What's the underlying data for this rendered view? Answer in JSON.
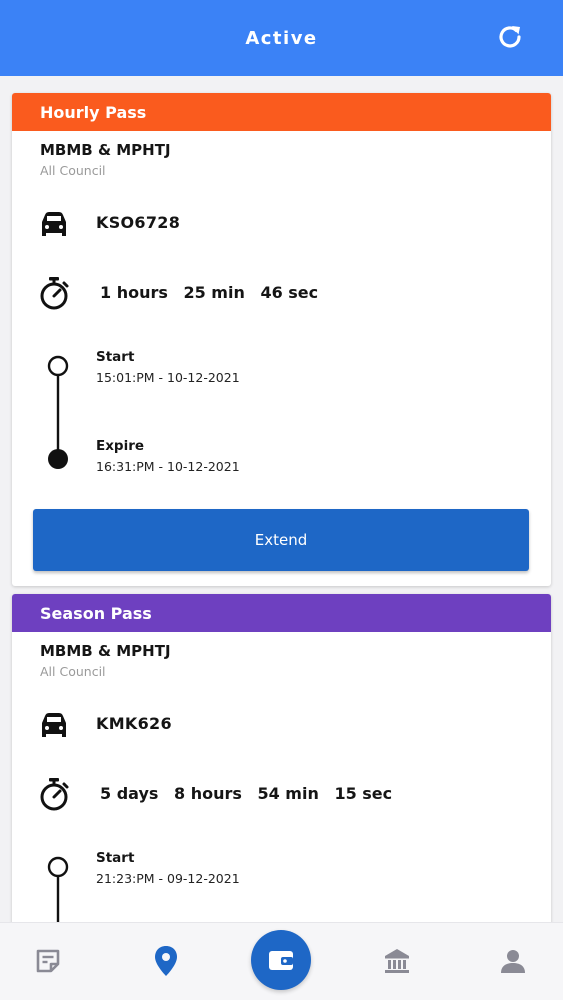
{
  "header": {
    "title": "Active"
  },
  "passes": [
    {
      "type_label": "Hourly Pass",
      "band_color": "#fa5b1e",
      "council": "MBMB & MPHTJ",
      "council_sub": "All Council",
      "plate": "KSO6728",
      "remaining": [
        "1 hours",
        "25 min",
        "46 sec"
      ],
      "start_label": "Start",
      "start_time": "15:01:PM - 10-12-2021",
      "expire_label": "Expire",
      "expire_time": "16:31:PM - 10-12-2021",
      "action_label": "Extend"
    },
    {
      "type_label": "Season Pass",
      "band_color": "#6e40c0",
      "council": "MBMB & MPHTJ",
      "council_sub": "All Council",
      "plate": "KMK626",
      "remaining": [
        "5 days",
        "8 hours",
        "54 min",
        "15 sec"
      ],
      "start_label": "Start",
      "start_time": "21:23:PM - 09-12-2021"
    }
  ],
  "nav": {
    "items": [
      "notes-icon",
      "location-pin-icon",
      "wallet-icon",
      "bank-icon",
      "profile-icon"
    ],
    "active_color": "#1e67c6",
    "inactive_color": "#8a8a95"
  }
}
